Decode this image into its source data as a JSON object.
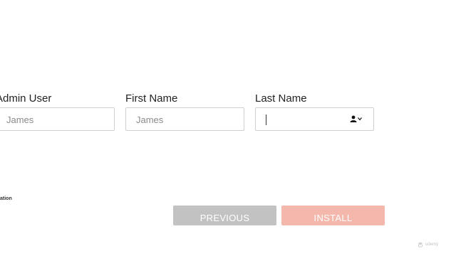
{
  "form": {
    "admin_user": {
      "label": "Admin User",
      "value": "James"
    },
    "first_name": {
      "label": "First Name",
      "value": "James"
    },
    "last_name": {
      "label": "Last Name",
      "value": "",
      "addon_icon": "user-icon"
    }
  },
  "footer": {
    "truncated_label": "ation"
  },
  "buttons": {
    "previous": "PREVIOUS",
    "install": "INSTALL"
  },
  "colors": {
    "previous_bg": "#c2c2c2",
    "install_bg": "#f3b8ab",
    "input_border": "#cfcfcf"
  },
  "watermark": {
    "text": "udemy"
  }
}
